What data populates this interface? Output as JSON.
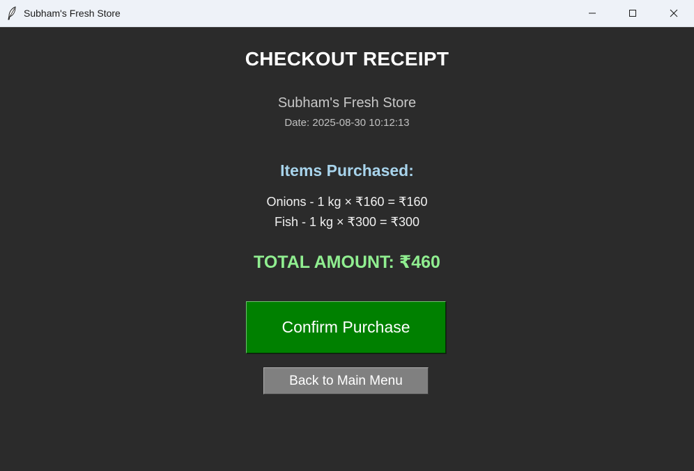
{
  "window": {
    "title": "Subham's Fresh Store",
    "icon": "feather-icon",
    "controls": [
      "minimize-icon",
      "maximize-icon",
      "close-icon"
    ]
  },
  "receipt": {
    "heading": "CHECKOUT RECEIPT",
    "store_name": "Subham's Fresh Store",
    "date": "Date: 2025-08-30 10:12:13",
    "items_heading": "Items Purchased:",
    "items": [
      "Onions - 1 kg × ₹160 = ₹160",
      "Fish - 1 kg × ₹300 = ₹300"
    ],
    "total": "TOTAL AMOUNT: ₹460"
  },
  "buttons": {
    "confirm_label": "Confirm Purchase",
    "back_label": "Back to Main Menu"
  },
  "colors": {
    "background": "#2b2b2b",
    "heading": "#ffffff",
    "items_heading": "#a8d4ec",
    "total": "#90ee90",
    "confirm_button": "#008000",
    "back_button": "#808080"
  }
}
